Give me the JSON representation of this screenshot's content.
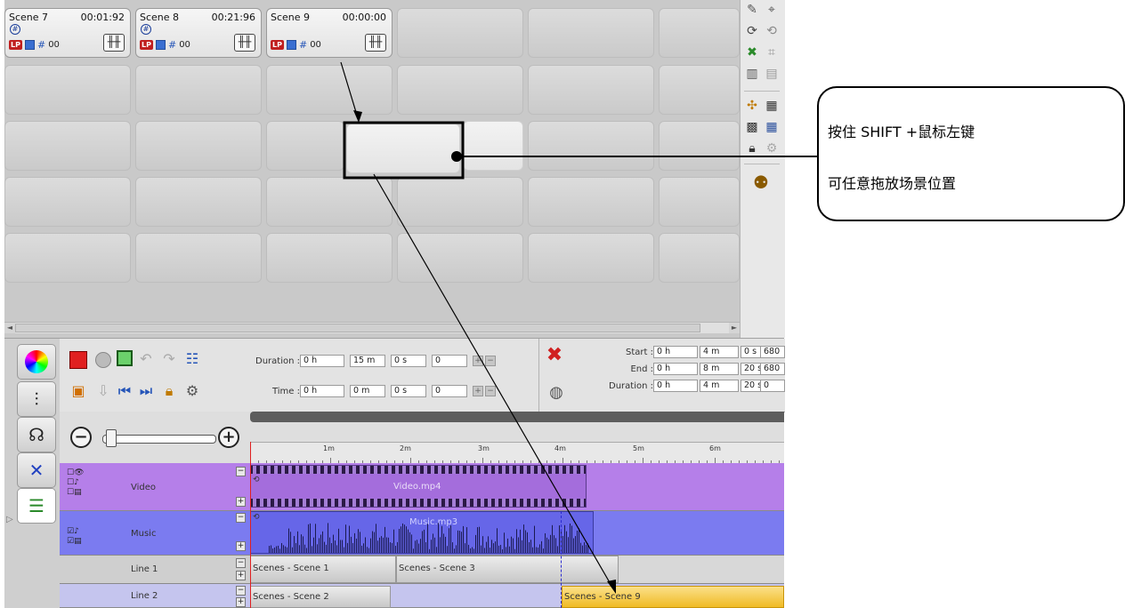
{
  "scenes": [
    {
      "name": "Scene 7",
      "time": "00:01:92",
      "has_hash": true,
      "badge_lp": "LP",
      "count": "00"
    },
    {
      "name": "Scene 8",
      "time": "00:21:96",
      "has_hash": true,
      "badge_lp": "LP",
      "count": "00"
    },
    {
      "name": "Scene 9",
      "time": "00:00:00",
      "has_hash": false,
      "badge_lp": "LP",
      "count": "00"
    }
  ],
  "callout": {
    "line1": "按住 SHIFT +鼠标左键",
    "line2": "可任意拖放场景位置"
  },
  "transport": {
    "duration_label": "Duration :",
    "duration": {
      "h": "0 h",
      "m": "15 m",
      "s": "0 s",
      "f": "0"
    },
    "time_label": "Time :",
    "time": {
      "h": "0 h",
      "m": "0 m",
      "s": "0 s",
      "f": "0"
    }
  },
  "range": {
    "start_label": "Start :",
    "start": {
      "h": "0 h",
      "m": "4 m",
      "s": "0 s",
      "f": "680"
    },
    "end_label": "End :",
    "end": {
      "h": "0 h",
      "m": "8 m",
      "s": "20 s",
      "f": "680"
    },
    "duration_label": "Duration :",
    "duration": {
      "h": "0 h",
      "m": "4 m",
      "s": "20 s",
      "f": "0"
    }
  },
  "ruler": {
    "labels": [
      "1m",
      "2m",
      "3m",
      "4m",
      "5m",
      "6m"
    ]
  },
  "tracks": {
    "video": {
      "name": "Video",
      "clip": "Video.mp4",
      "color": "#b57fe9"
    },
    "music": {
      "name": "Music",
      "clip": "Music.mp3",
      "color": "#7b7bf0"
    },
    "line1": {
      "name": "Line 1",
      "clips": [
        "Scenes - Scene 1",
        "Scenes - Scene 3"
      ]
    },
    "line2": {
      "name": "Line 2",
      "clips": [
        "Scenes - Scene 2",
        "Scenes - Scene 9"
      ]
    }
  },
  "colors": {
    "video_track": "#b57fe9",
    "music_track": "#7b7bf0",
    "line2_track": "#c5c5ee",
    "selected_clip": "#f5c842",
    "playhead": "#e02020"
  },
  "icons": {
    "left_tabs": [
      "color-wheel-icon",
      "mixer-icon",
      "audio-settings-icon",
      "curve-icon",
      "timeline-icon"
    ],
    "transport": [
      "stop-icon",
      "record-icon",
      "pause-icon",
      "undo-icon",
      "redo-icon",
      "list-icon",
      "media-icon",
      "download-icon",
      "prev-icon",
      "next-icon",
      "lock-icon",
      "settings-icon"
    ],
    "range": [
      "delete-icon",
      "palette-icon"
    ]
  }
}
